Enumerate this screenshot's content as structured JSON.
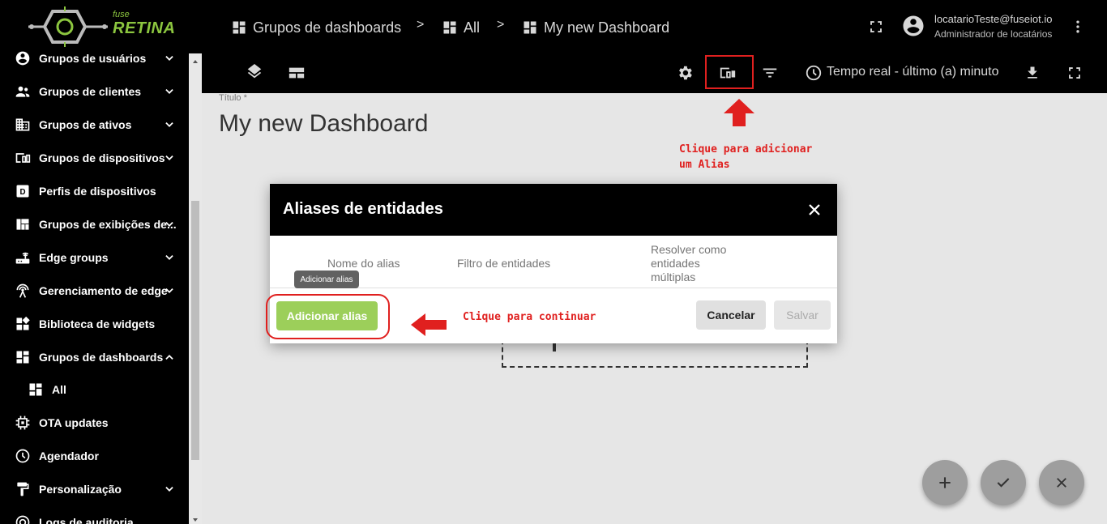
{
  "logo": {
    "small": "fuse",
    "big": "RETINA"
  },
  "sidebar": {
    "items": [
      {
        "label": "Grupos de usuários",
        "icon": "account-circle-icon",
        "chevron": "down"
      },
      {
        "label": "Grupos de clientes",
        "icon": "supervisor-account-icon",
        "chevron": "down"
      },
      {
        "label": "Grupos de ativos",
        "icon": "domain-icon",
        "chevron": "down"
      },
      {
        "label": "Grupos de dispositivos",
        "icon": "devices-other-icon",
        "chevron": "down"
      },
      {
        "label": "Perfis de dispositivos",
        "icon": "device-profile-icon",
        "chevron": ""
      },
      {
        "label": "Grupos de exibições de...",
        "icon": "view-quilt-icon",
        "chevron": "down"
      },
      {
        "label": "Edge groups",
        "icon": "router-icon",
        "chevron": "down"
      },
      {
        "label": "Gerenciamento de edge",
        "icon": "settings-input-antenna-icon",
        "chevron": "down"
      },
      {
        "label": "Biblioteca de widgets",
        "icon": "widgets-icon",
        "chevron": ""
      },
      {
        "label": "Grupos de dashboards",
        "icon": "dashboard-icon",
        "chevron": "up"
      },
      {
        "label": "All",
        "icon": "dashboard-icon",
        "chevron": "",
        "sub": true
      },
      {
        "label": "OTA updates",
        "icon": "memory-icon",
        "chevron": ""
      },
      {
        "label": "Agendador",
        "icon": "schedule-icon",
        "chevron": ""
      },
      {
        "label": "Personalização",
        "icon": "format-paint-icon",
        "chevron": "down"
      },
      {
        "label": "Logs de auditoria",
        "icon": "track-changes-icon",
        "chevron": ""
      }
    ]
  },
  "breadcrumb": {
    "items": [
      "Grupos de dashboards",
      "All",
      "My new Dashboard"
    ],
    "separator": ">"
  },
  "user": {
    "name": "locatarioTeste@fuseiot.io",
    "role": "Administrador de locatários"
  },
  "toolbar": {
    "time_label": "Tempo real - último (a) minuto"
  },
  "dashboard": {
    "title_label": "Título *",
    "title": "My new Dashboard"
  },
  "annotations": {
    "alias_hint_line1": "Clique para adicionar",
    "alias_hint_line2": "um Alias",
    "continue_hint": "Clique para continuar"
  },
  "dialog": {
    "title": "Aliases de entidades",
    "columns": {
      "alias_name": "Nome do alias",
      "entity_filter": "Filtro de entidades",
      "resolve_multiple_1": "Resolver como",
      "resolve_multiple_2": "entidades",
      "resolve_multiple_3": "múltiplas"
    },
    "tooltip": "Adicionar alias",
    "add_button": "Adicionar alias",
    "cancel_button": "Cancelar",
    "save_button": "Salvar"
  },
  "colors": {
    "brand_green": "#8cc63f",
    "add_button": "#9ccf5a",
    "annotation_red": "#e0201f",
    "header_bg": "#000000"
  }
}
